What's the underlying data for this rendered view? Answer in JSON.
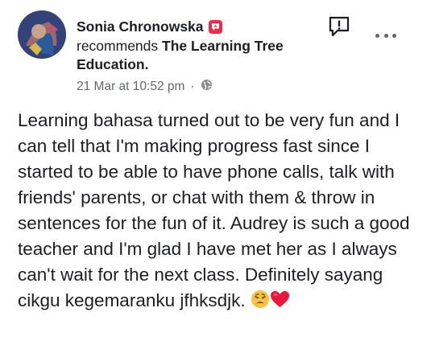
{
  "post": {
    "author": "Sonia Chronowska",
    "recommends_prefix": "recommends ",
    "page_name": "The Learning Tree Education.",
    "timestamp": "21 Mar at 10:52 pm",
    "separator": "·",
    "privacy_icon": "globe-icon",
    "badge_icon": "recommendation-badge-icon",
    "report_icon": "report-icon",
    "more_icon": "more-options-icon",
    "body": "Learning bahasa turned out to be very fun and I can tell that I'm making progress fast since I started to be able to have phone calls, talk with friends' parents, or chat with them & throw in sentences for the fun of it. Audrey is such a good teacher and I'm glad I have met her as I always can't wait for the next class. Definitely sayang cikgu kegemaranku jfhksdjk. ",
    "emojis": [
      "weary-face-icon",
      "red-heart-icon"
    ]
  },
  "colors": {
    "badge": "#f02849",
    "secondary_text": "#65676b",
    "primary_text": "#1c1e21"
  }
}
